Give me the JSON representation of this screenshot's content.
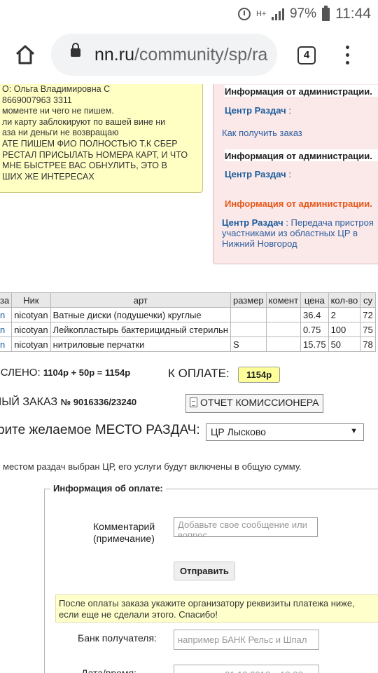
{
  "status_bar": {
    "network_type": "H+",
    "battery": "97%",
    "time": "11:44"
  },
  "browser": {
    "url_host": "nn.ru",
    "url_path": "/community/sp/ra",
    "tab_count": "4"
  },
  "yellow_note": {
    "lines": [
      "О: Ольга Владимировна С",
      "8669007963 3311",
      "моменте ни чего не пишем.",
      "ли карту заблокируют по вашей вине ни",
      "аза ни деньги не возвращаю",
      "АТЕ ПИШЕМ ФИО ПОЛНОСТЬЮ Т.К СБЕР",
      "РЕСТАЛ ПРИСЫЛАТЬ НОМЕРА КАРТ, И ЧТО",
      "МНЕ БЫСТРЕЕ ВАС ОБНУЛИТЬ, ЭТО В",
      "ШИХ ЖЕ ИНТЕРЕСАХ"
    ]
  },
  "admin_panel": {
    "header": "Информация от администрации.",
    "center_label": "Центр Раздач",
    "colon": " :",
    "link_how": "Как получить заказ",
    "orange_header": "Информация от администрации.",
    "transfer_center": "Центр Раздач",
    "transfer_text": " : Передача пристроя участниками из областных ЦР в Нижний Новгород"
  },
  "table": {
    "headers": [
      "за",
      "Ник",
      "арт",
      "размер",
      "комент",
      "цена",
      "кол-во",
      "су"
    ],
    "rows": [
      [
        "n",
        "nicotyan",
        "Ватные диски (подушечки) круглые",
        "",
        "",
        "36.4",
        "2",
        "72"
      ],
      [
        "n",
        "nicotyan",
        "Лейкопластырь бактерицидный стерильн",
        "",
        "",
        "0.75",
        "100",
        "75"
      ],
      [
        "n",
        "nicotyan",
        "нитриловые перчатки",
        "S",
        "",
        "15.75",
        "50",
        "78"
      ]
    ]
  },
  "summary": {
    "charged_label": "ИСЛЕНО:",
    "charged_formula": "1104р + 50р = 1154р",
    "to_pay_label": "К ОПЛАТЕ:",
    "to_pay_value": "1154р"
  },
  "order": {
    "label": "РНЫЙ ЗАКАЗ",
    "number": "№ 9016336/23240",
    "report_button": "ОТЧЕТ КОМИССИОНЕРА"
  },
  "pickup": {
    "label": "рите желаемое МЕСТО РАЗДАЧ:",
    "selected": "ЦР Лысково",
    "note": "местом раздач выбран ЦР, его услуги будут включены в общую сумму."
  },
  "payment": {
    "legend": "Информация об оплате:",
    "comment_label_1": "Комментарий",
    "comment_label_2": "(примечание)",
    "comment_placeholder": "Добавьте свое сообщение или вопрос",
    "send_button": "Отправить",
    "info_line_1": "После оплаты заказа укажите организатору реквизиты платежа ниже,",
    "info_line_2": "если еще не сделали этого. Спасибо!",
    "bank_label": "Банк получателя:",
    "bank_placeholder": "например БАНК Рельс и Шпал",
    "date_label": "Дата/время:",
    "date_placeholder": "01.12.2018 в 10:00"
  }
}
